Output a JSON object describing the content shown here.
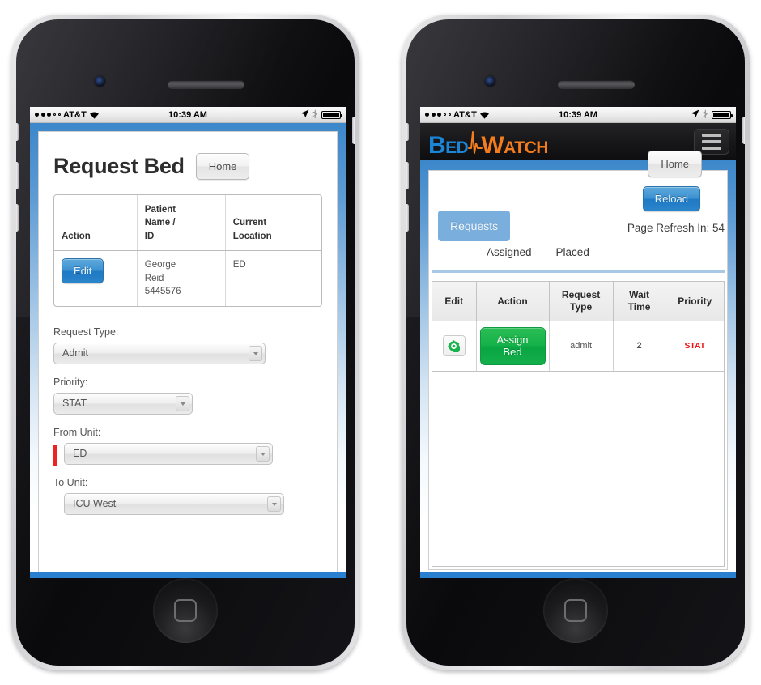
{
  "statusbar": {
    "carrier": "AT&T",
    "time": "10:39 AM",
    "signal_filled": 3,
    "signal_empty": 2
  },
  "left_phone": {
    "page_title": "Request Bed",
    "home_button": "Home",
    "patient_table": {
      "headers": [
        "Action",
        "Patient Name / ID",
        "Current Location"
      ],
      "header_lines": [
        [
          "Action"
        ],
        [
          "Patient",
          "Name /",
          "ID"
        ],
        [
          "Current",
          "Location"
        ]
      ],
      "rows": [
        {
          "action_label": "Edit",
          "patient": [
            "George",
            "Reid",
            "5445576"
          ],
          "location": "ED"
        }
      ]
    },
    "fields": [
      {
        "label": "Request Type:",
        "value": "Admit",
        "required": false
      },
      {
        "label": "Priority:",
        "value": "STAT",
        "required": false
      },
      {
        "label": "From Unit:",
        "value": "ED",
        "required": true
      },
      {
        "label": "To Unit:",
        "value": "ICU West",
        "required": false
      }
    ]
  },
  "right_phone": {
    "logo": {
      "part1": "Bed",
      "part2": "Watch",
      "color1": "#1b85d6",
      "color2": "#f47c1c"
    },
    "menu_icon": "hamburger-icon",
    "home_button": "Home",
    "reload_button": "Reload",
    "requests_tab": "Requests",
    "refresh_text": "Page Refresh In: 54",
    "sub_tabs": [
      "Assigned",
      "Placed"
    ],
    "requests_table": {
      "headers": [
        "Edit",
        "Action",
        "Request Type",
        "Wait Time",
        "Priority"
      ],
      "header_lines": [
        [
          "Edit"
        ],
        [
          "Action"
        ],
        [
          "Request",
          "Type"
        ],
        [
          "Wait",
          "Time"
        ],
        [
          "Priority"
        ]
      ],
      "rows": [
        {
          "edit_icon": "gear-icon",
          "action_label": "Assign Bed",
          "request_type": "admit",
          "wait_time": "2",
          "priority": "STAT",
          "priority_color": "#ee1111"
        }
      ]
    }
  }
}
